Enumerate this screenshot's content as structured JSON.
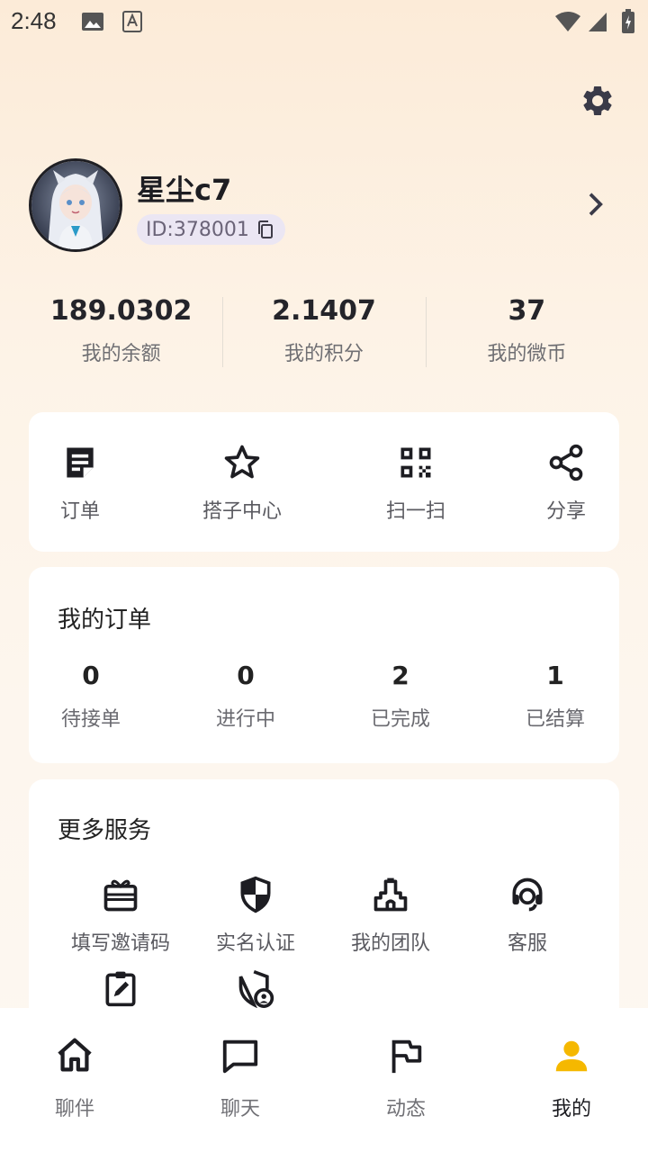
{
  "status_bar": {
    "time": "2:48"
  },
  "profile": {
    "nickname": "星尘c7",
    "id_label": "ID:378001"
  },
  "stats": [
    {
      "value": "189.0302",
      "label": "我的余额"
    },
    {
      "value": "2.1407",
      "label": "我的积分"
    },
    {
      "value": "37",
      "label": "我的微币"
    }
  ],
  "quick_actions": [
    {
      "label": "订单",
      "icon": "order-note-icon"
    },
    {
      "label": "搭子中心",
      "icon": "star-icon"
    },
    {
      "label": "扫一扫",
      "icon": "qr-code-icon"
    },
    {
      "label": "分享",
      "icon": "share-icon"
    }
  ],
  "orders": {
    "title": "我的订单",
    "items": [
      {
        "count": "0",
        "label": "待接单"
      },
      {
        "count": "0",
        "label": "进行中"
      },
      {
        "count": "2",
        "label": "已完成"
      },
      {
        "count": "1",
        "label": "已结算"
      }
    ]
  },
  "services": {
    "title": "更多服务",
    "items": [
      {
        "label": "填写邀请码",
        "icon": "gift-card-icon"
      },
      {
        "label": "实名认证",
        "icon": "shield-icon"
      },
      {
        "label": "我的团队",
        "icon": "team-castle-icon"
      },
      {
        "label": "客服",
        "icon": "headset-icon"
      },
      {
        "label": "",
        "icon": "clipboard-edit-icon"
      },
      {
        "label": "",
        "icon": "shield-user-icon"
      }
    ]
  },
  "tabs": [
    {
      "label": "聊伴",
      "icon": "home-icon",
      "active": false
    },
    {
      "label": "聊天",
      "icon": "chat-icon",
      "active": false
    },
    {
      "label": "动态",
      "icon": "flag-icon",
      "active": false
    },
    {
      "label": "我的",
      "icon": "person-icon",
      "active": true
    }
  ],
  "colors": {
    "accent_active_tab": "#f5b800",
    "text_primary": "#1d1d22",
    "card_bg": "#ffffff",
    "id_pill_bg": "#ebe6f3"
  }
}
